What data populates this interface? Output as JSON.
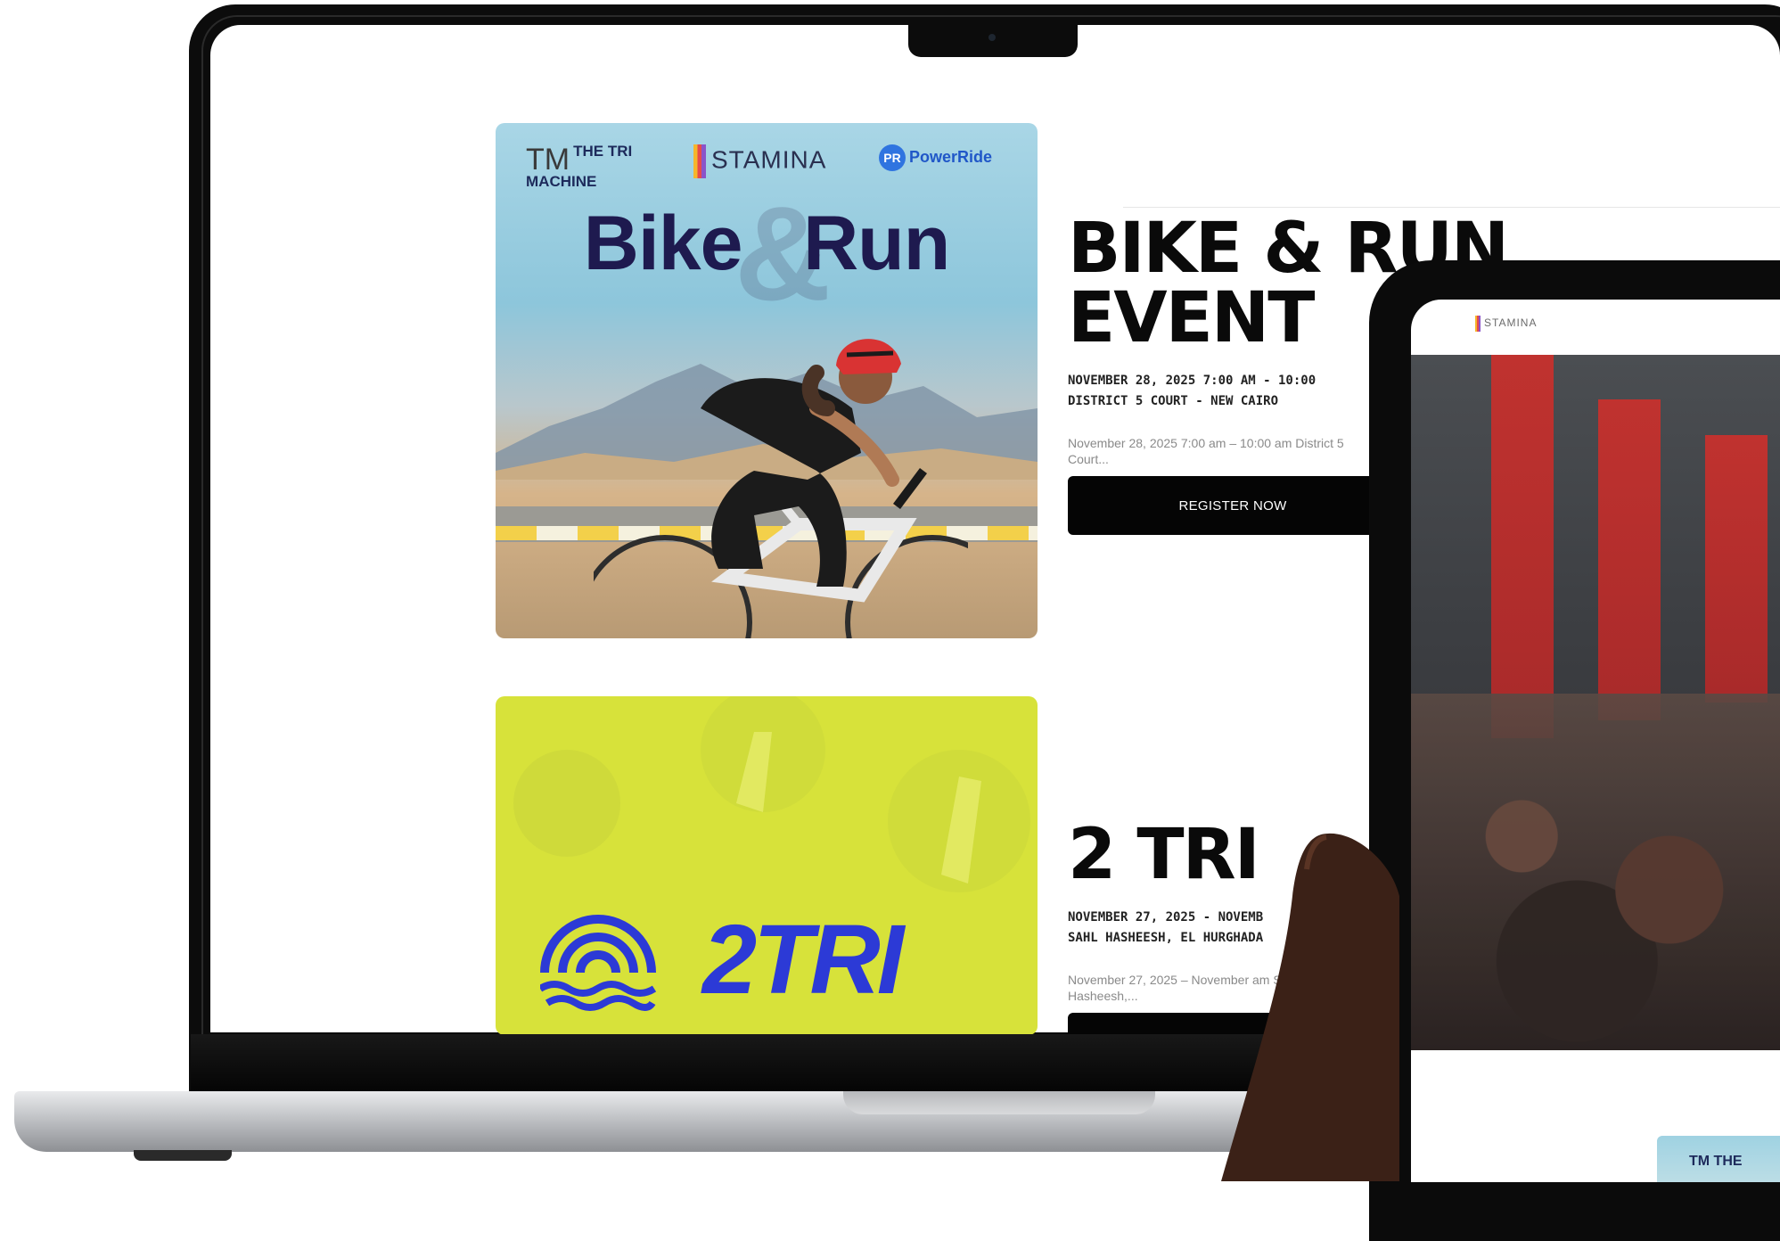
{
  "events": [
    {
      "sponsors": {
        "tri_line1": "THE TRI",
        "tri_line2": "MACHINE",
        "tri_mark": "TM",
        "stamina": "STAMINA",
        "power": "PowerRide",
        "power_badge": "PR"
      },
      "poster_title": "Bike   Run",
      "poster_amp": "&",
      "title_line1": "BIKE & RUN",
      "title_line2": "EVENT",
      "meta_line1": "NOVEMBER 28, 2025 7:00 AM - 10:00",
      "meta_line2": "DISTRICT 5 COURT - NEW CAIRO",
      "excerpt": "November 28, 2025 7:00 am – 10:00 am District 5 Court...",
      "button_label": "REGISTER NOW"
    },
    {
      "poster_word": "2TRI",
      "title_line1": "2 TRI",
      "meta_line1": "NOVEMBER 27, 2025 - NOVEMB",
      "meta_line2": "SAHL HASHEESH, EL HURGHADA",
      "excerpt": "November 27, 2025 – November am Sahl Hasheesh,..."
    }
  ],
  "tablet": {
    "logo_text": "STAMINA",
    "thumb_text": "TM THE"
  },
  "colors": {
    "button_bg": "#050505",
    "title_text": "#0a0a0a",
    "poster_navy": "#1e1a4f",
    "tri_blue": "#2c3ad6",
    "tri_yellow": "#d7e23a"
  }
}
